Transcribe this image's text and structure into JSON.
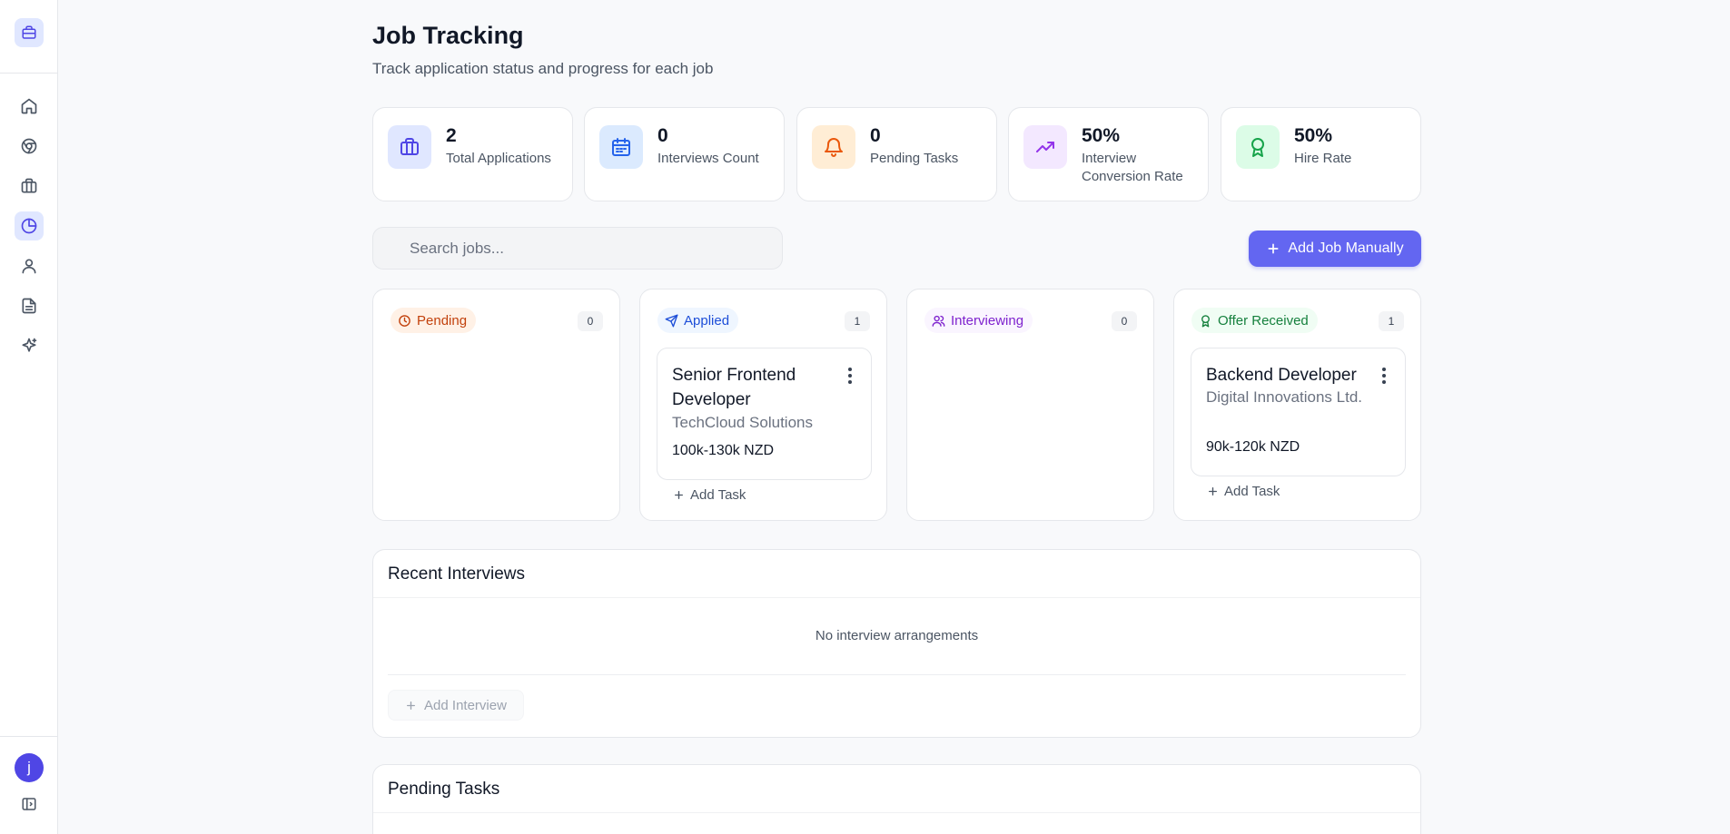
{
  "header": {
    "title": "Job Tracking",
    "subtitle": "Track application status and progress for each job"
  },
  "sidebar": {
    "logo_icon": "briefcase-icon",
    "items": [
      {
        "icon": "home-icon",
        "active": false
      },
      {
        "icon": "chrome-icon",
        "active": false
      },
      {
        "icon": "briefcase-icon",
        "active": false
      },
      {
        "icon": "pie-chart-icon",
        "active": true
      },
      {
        "icon": "user-icon",
        "active": false
      },
      {
        "icon": "document-icon",
        "active": false
      },
      {
        "icon": "sparkle-icon",
        "active": false
      }
    ],
    "avatar_initial": "j",
    "collapse_icon": "panel-toggle-icon"
  },
  "stats": [
    {
      "value": "2",
      "label": "Total Applications",
      "icon": "briefcase-icon",
      "bg": "#e0e7ff",
      "fg": "#4f46e5"
    },
    {
      "value": "0",
      "label": "Interviews Count",
      "icon": "calendar-icon",
      "bg": "#dbeafe",
      "fg": "#2563eb"
    },
    {
      "value": "0",
      "label": "Pending Tasks",
      "icon": "bell-icon",
      "bg": "#ffedd5",
      "fg": "#ea580c"
    },
    {
      "value": "50%",
      "label": "Interview Conversion Rate",
      "icon": "trending-up-icon",
      "bg": "#f3e8ff",
      "fg": "#9333ea"
    },
    {
      "value": "50%",
      "label": "Hire Rate",
      "icon": "award-icon",
      "bg": "#dcfce7",
      "fg": "#16a34a"
    }
  ],
  "search": {
    "placeholder": "Search jobs...",
    "value": ""
  },
  "add_job_label": "Add Job Manually",
  "columns": [
    {
      "title": "Pending",
      "count": "0",
      "icon": "clock-icon",
      "bg": "#fff1e6",
      "fg": "#c2410c",
      "jobs": []
    },
    {
      "title": "Applied",
      "count": "1",
      "icon": "send-icon",
      "bg": "#eff6ff",
      "fg": "#1d4ed8",
      "jobs": [
        {
          "title": "Senior Frontend Developer",
          "company": "TechCloud Solutions",
          "salary": "100k-130k NZD"
        }
      ],
      "add_task_label": "Add Task"
    },
    {
      "title": "Interviewing",
      "count": "0",
      "icon": "users-icon",
      "bg": "#faf5ff",
      "fg": "#7e22ce",
      "jobs": []
    },
    {
      "title": "Offer Received",
      "count": "1",
      "icon": "award-icon",
      "bg": "#f0fdf4",
      "fg": "#15803d",
      "jobs": [
        {
          "title": "Backend Developer",
          "company": "Digital Innovations Ltd.",
          "salary": "90k-120k NZD"
        }
      ],
      "add_task_label": "Add Task"
    }
  ],
  "recent_interviews": {
    "title": "Recent Interviews",
    "empty_text": "No interview arrangements",
    "add_label": "Add Interview"
  },
  "pending_tasks": {
    "title": "Pending Tasks"
  }
}
